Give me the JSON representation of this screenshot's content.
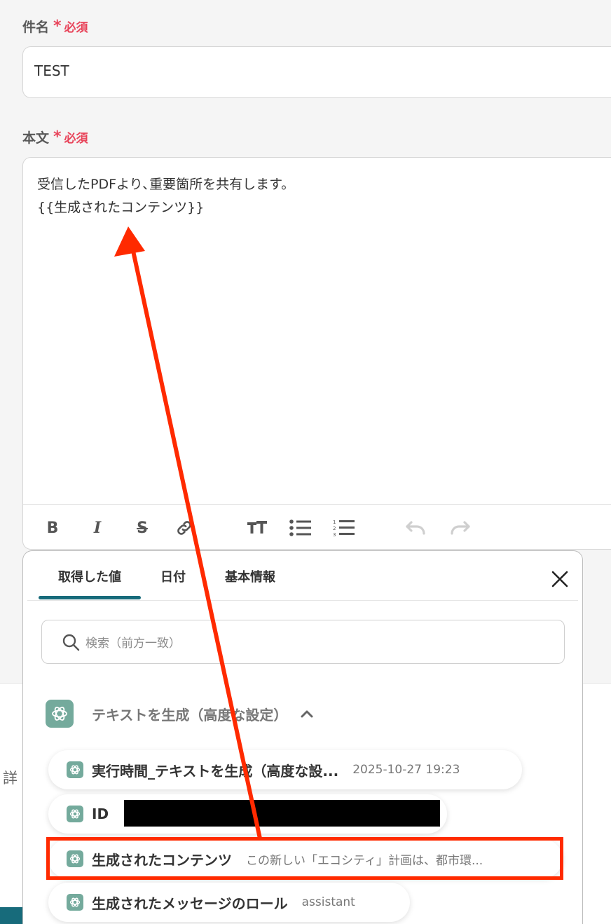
{
  "subject": {
    "label": "件名",
    "required_star": "*",
    "required_text": "必須",
    "value": "TEST"
  },
  "body": {
    "label": "本文",
    "required_star": "*",
    "required_text": "必須",
    "line1": "受信したPDFより､重要箇所を共有します。",
    "line2": "{{生成されたコンテンツ}}"
  },
  "toolbar": {
    "bold": "B",
    "italic": "I",
    "strike": "S",
    "icons": [
      "link-icon",
      "text-size-icon",
      "bullet-list-icon",
      "numbered-list-icon",
      "undo-icon",
      "redo-icon"
    ]
  },
  "left_strip": {
    "text": "詳"
  },
  "panel": {
    "tabs": [
      "取得した値",
      "日付",
      "基本情報"
    ],
    "active_tab": 0,
    "search": {
      "placeholder": "検索（前方一致）"
    },
    "group": {
      "title": "テキストを生成（高度な設定）",
      "icon": "chatgpt-icon"
    },
    "items": [
      {
        "name": "実行時間_テキストを生成（高度な設...",
        "value": "2025-10-27 19:23"
      },
      {
        "name": "ID",
        "value": ""
      },
      {
        "name": "生成されたコンテンツ",
        "value": "この新しい「エコシティ」計画は、都市環..."
      },
      {
        "name": "生成されたメッセージのロール",
        "value": "assistant"
      }
    ]
  },
  "colors": {
    "accent": "#176b7b",
    "required": "#e8445a",
    "annotation": "#ff2a00",
    "gpt": "#74aa9c"
  }
}
